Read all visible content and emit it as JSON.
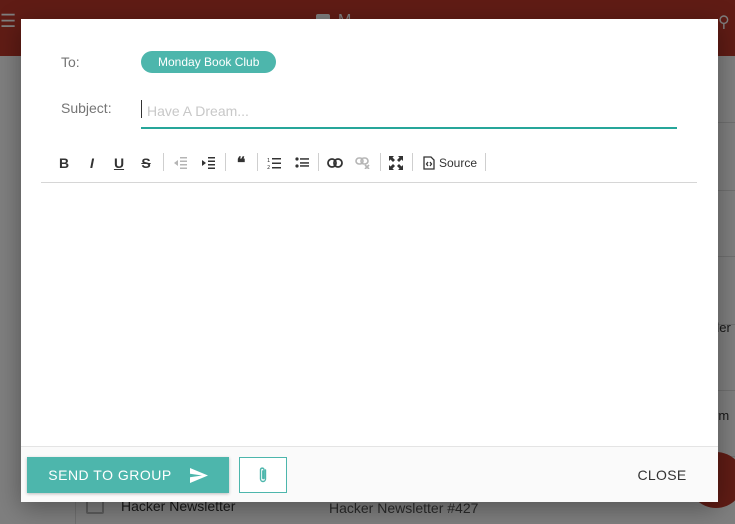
{
  "background": {
    "title": "M",
    "rows": [
      {
        "col1": "Hacker Newsletter",
        "col2": "Hacker Newsletter #427"
      }
    ],
    "side_snippets": [
      "der",
      "rm",
      "ro"
    ]
  },
  "compose": {
    "to_label": "To:",
    "to_chip": "Monday Book Club",
    "subject_label": "Subject:",
    "subject_value": "",
    "subject_placeholder": "Have A Dream...",
    "toolbar": {
      "bold": "B",
      "italic": "I",
      "underline": "U",
      "strike": "S",
      "source_label": "Source"
    },
    "footer": {
      "send_label": "SEND TO GROUP",
      "close_label": "CLOSE"
    }
  },
  "colors": {
    "accent": "#4db6ac",
    "accent_line": "#26a69a",
    "app_bar": "#c0392b"
  }
}
